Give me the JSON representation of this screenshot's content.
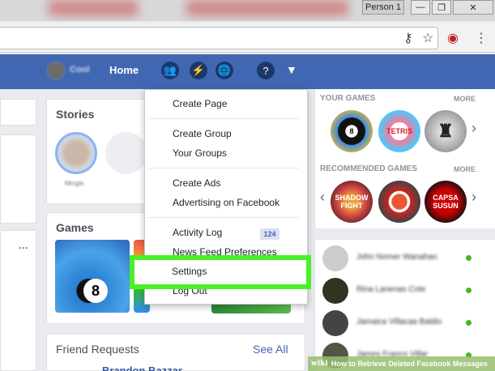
{
  "window": {
    "profile_label": "Person 1",
    "min_glyph": "—",
    "max_glyph": "❐",
    "close_glyph": "✕"
  },
  "address_bar": {
    "key_icon": "key-icon",
    "star_icon": "star-icon",
    "ext_icon": "extension-icon"
  },
  "navbar": {
    "user_name": "Cool",
    "home_label": "Home",
    "icons": [
      "friends-icon",
      "messenger-icon",
      "globe-icon",
      "help-icon"
    ],
    "caret": "▼"
  },
  "left": {
    "more_label": "···"
  },
  "stories": {
    "title": "Stories",
    "story_name": "Mingle"
  },
  "games": {
    "title": "Games"
  },
  "friend_requests": {
    "title": "Friend Requests",
    "see_all": "See All",
    "first_name": "Brandon Bazzar"
  },
  "right": {
    "your_games_title": "YOUR GAMES",
    "your_games_more": "MORE",
    "recommended_title": "RECOMMENDED GAMES",
    "recommended_more": "MORE",
    "your_games": [
      "8",
      "TETRIS",
      "♜"
    ],
    "recommended": [
      "SHADOW FIGHT",
      "",
      "CAPSA SUSUN"
    ],
    "chats": [
      "John Nomer Wanahan",
      "Rina Lanenas Cote",
      "Jamaica Villacaa Baldio",
      "James Franco Villar"
    ]
  },
  "menu": {
    "items": [
      "Create Page",
      "Create Group",
      "Your Groups",
      "Create Ads",
      "Advertising on Facebook",
      "Activity Log",
      "News Feed Preferences",
      "Settings",
      "Log Out"
    ],
    "activity_badge": "124"
  },
  "watermark": {
    "logo": "wiki",
    "text": "How to Retrieve Deleted Facebook Messages"
  },
  "colors": {
    "fb_blue": "#4267b2",
    "highlight_green": "#4bf026"
  }
}
